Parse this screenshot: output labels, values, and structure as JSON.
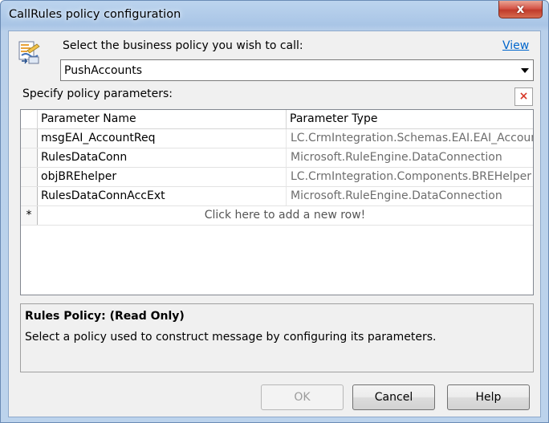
{
  "window": {
    "title": "CallRules policy configuration",
    "close_glyph": "x"
  },
  "policy": {
    "select_label": "Select the business policy you wish to call:",
    "view_link": "View",
    "selected": "PushAccounts",
    "icon": "policy-rules-icon"
  },
  "params": {
    "label": "Specify policy parameters:",
    "delete_glyph": "×",
    "columns": [
      "Parameter Name",
      "Parameter Type"
    ],
    "rows": [
      {
        "name": "msgEAI_AccountReq",
        "type": "LC.CrmIntegration.Schemas.EAI.EAI_Account"
      },
      {
        "name": "RulesDataConn",
        "type": "Microsoft.RuleEngine.DataConnection"
      },
      {
        "name": "objBREhelper",
        "type": "LC.CrmIntegration.Components.BREHelper"
      },
      {
        "name": "RulesDataConnAccExt",
        "type": "Microsoft.RuleEngine.DataConnection"
      }
    ],
    "new_row_marker": "*",
    "new_row_text": "Click here to add a new row!"
  },
  "info": {
    "title": "Rules Policy: (Read Only)",
    "description": "Select a policy used to construct message by configuring its parameters."
  },
  "buttons": {
    "ok": "OK",
    "cancel": "Cancel",
    "help": "Help"
  },
  "colors": {
    "link": "#0066cc",
    "close": "#c03b2b",
    "delete": "#d83a2a"
  }
}
